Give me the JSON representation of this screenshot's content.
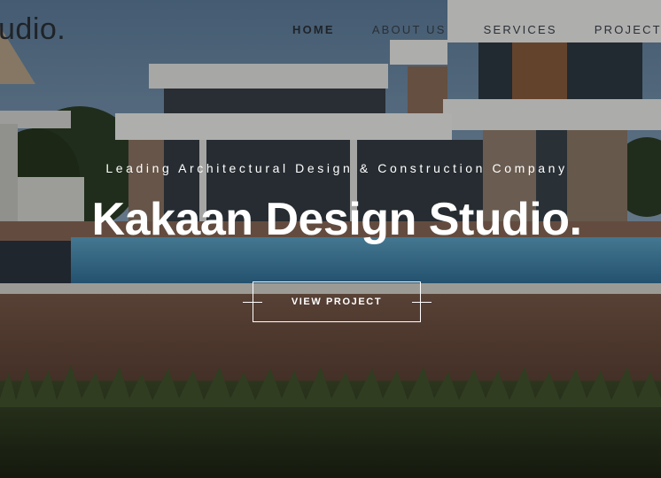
{
  "header": {
    "logo_text": "udio.",
    "nav": [
      {
        "label": "HOME"
      },
      {
        "label": "ABOUT US"
      },
      {
        "label": "SERVICES"
      },
      {
        "label": "PROJECTS"
      }
    ]
  },
  "hero": {
    "tagline": "Leading Architectural Design & Construction Company",
    "headline": "Kakaan Design Studio.",
    "cta_label": "VIEW PROJECT"
  },
  "icons": [
    "dash-left-icon",
    "dash-right-icon"
  ]
}
